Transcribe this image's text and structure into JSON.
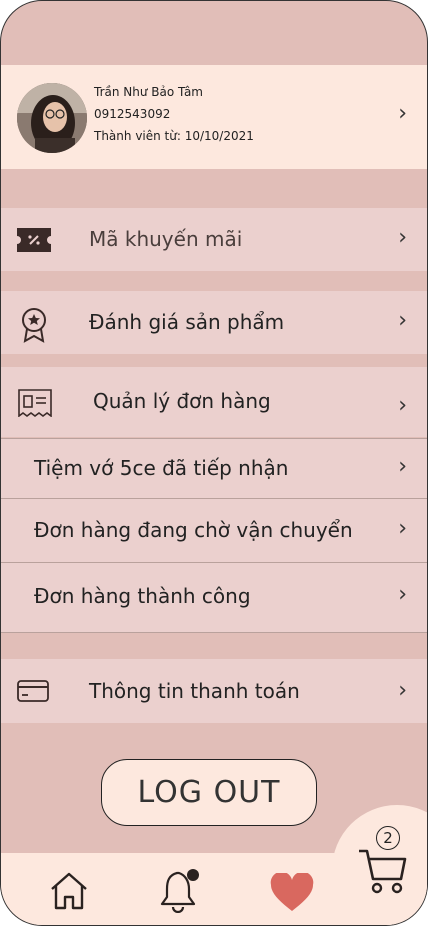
{
  "profile": {
    "name": "Trần Như Bảo Tâm",
    "phone": "0912543092",
    "member_since": "Thành viên từ: 10/10/2021"
  },
  "menu": {
    "promo": "Mã khuyến mãi",
    "review": "Đánh giá sản phẩm",
    "orders": "Quản lý đơn hàng",
    "received": "Tiệm vớ 5ce đã tiếp nhận",
    "shipping": "Đơn hàng đang chờ vận chuyển",
    "success": "Đơn hàng thành công",
    "payment": "Thông tin thanh toán"
  },
  "logout_label": "LOG OUT",
  "cart_count": "2",
  "chevron": "›",
  "icons": [
    "ticket-icon",
    "award-icon",
    "receipt-icon",
    "card-icon",
    "home-icon",
    "bell-icon",
    "heart-icon",
    "cart-icon"
  ],
  "colors": {
    "background": "#e1beb8",
    "row": "#ebd0ce",
    "cream": "#fde8de",
    "heart": "#d9685f"
  }
}
